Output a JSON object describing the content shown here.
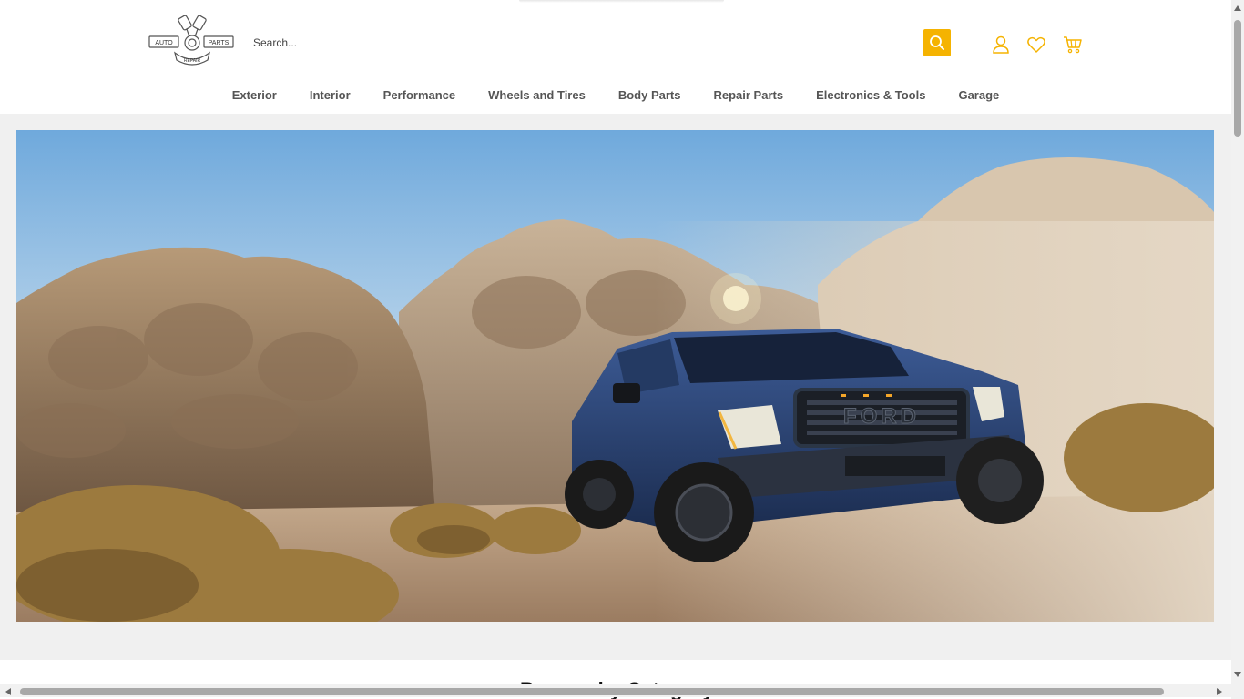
{
  "brand": {
    "logo_text_left": "AUTO",
    "logo_text_right": "PARTS",
    "logo_text_bottom": "REPAIR",
    "accent_color": "#f5b301"
  },
  "search": {
    "placeholder": "Search...",
    "button_icon": "search-icon"
  },
  "header_icons": {
    "account": "user-icon",
    "wishlist": "heart-icon",
    "cart": "cart-icon"
  },
  "nav": {
    "items": [
      {
        "label": "Exterior"
      },
      {
        "label": "Interior"
      },
      {
        "label": "Performance"
      },
      {
        "label": "Wheels and Tires"
      },
      {
        "label": "Body Parts"
      },
      {
        "label": "Repair Parts"
      },
      {
        "label": "Electronics & Tools"
      },
      {
        "label": "Garage"
      }
    ]
  },
  "hero": {
    "grille_text": "FORD"
  },
  "section": {
    "title": "Browse by Category"
  }
}
